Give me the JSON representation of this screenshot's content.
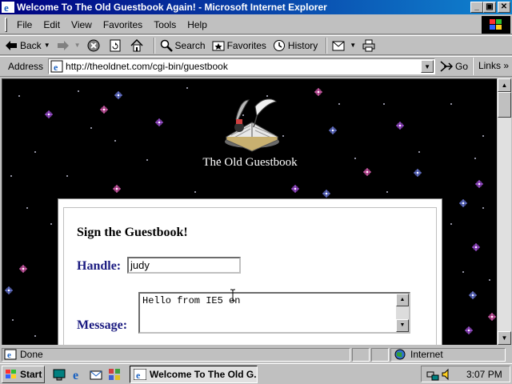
{
  "window": {
    "title": "Welcome To The Old Guestbook Again! - Microsoft Internet Explorer",
    "minimize_label": "_",
    "maximize_label": "▣",
    "close_label": "✕"
  },
  "menu": {
    "items": [
      {
        "name": "file",
        "label": "File"
      },
      {
        "name": "edit",
        "label": "Edit"
      },
      {
        "name": "view",
        "label": "View"
      },
      {
        "name": "favorites",
        "label": "Favorites"
      },
      {
        "name": "tools",
        "label": "Tools"
      },
      {
        "name": "help",
        "label": "Help"
      }
    ]
  },
  "toolbar": {
    "back_label": "Back",
    "search_label": "Search",
    "favorites_label": "Favorites",
    "history_label": "History"
  },
  "address": {
    "label": "Address",
    "url": "http://theoldnet.com/cgi-bin/guestbook",
    "go_label": "Go",
    "links_label": "Links"
  },
  "page": {
    "site_title": "The Old Guestbook",
    "form_heading": "Sign the Guestbook!",
    "handle_label": "Handle:",
    "handle_value": "judy",
    "message_label": "Message:",
    "message_value": "Hello from IE5 on"
  },
  "status": {
    "text": "Done",
    "zone": "Internet"
  },
  "taskbar": {
    "start_label": "Start",
    "task_label": "Welcome To The Old G...",
    "clock": "3:07 PM"
  },
  "colors": {
    "titlebar_start": "#000080",
    "titlebar_end": "#1084d0",
    "page_background": "#000000",
    "form_label": "#1a1a80"
  }
}
